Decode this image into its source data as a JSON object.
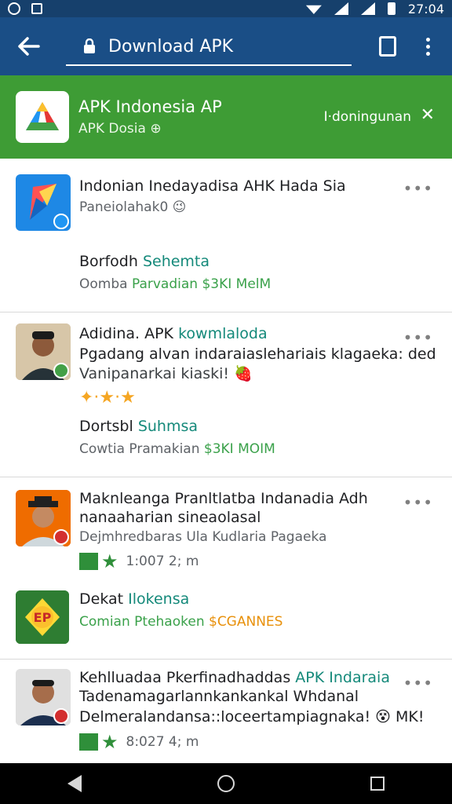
{
  "status": {
    "time": "27:04"
  },
  "toolbar": {
    "title": "Download APK"
  },
  "banner": {
    "title": "APK Indonesia AP",
    "subtitle": "APK Dosia",
    "subtitle_badge": "⊕",
    "action": "I·doningunan",
    "close": "✕"
  },
  "items": [
    {
      "title": "Indonian Inedayadisa AHK Hada Sia",
      "subtitle": "Paneiolahak0",
      "subtitle_emoji": "😉",
      "meta_label": "Borfodh",
      "meta_accent": "Sehemta",
      "footer_prefix": "Oomba",
      "footer_accent": "Parvadian $3KI MelM",
      "more": "•••"
    },
    {
      "title_prefix": "Adidina. APK",
      "title_accent": "kowmlaloda",
      "line2": "Pgadang alvan indaraiaslehariais klagaeka: ded",
      "line3": "Vanipanarkai kiaski!",
      "line3_emoji": "🍓",
      "stars": "✦·★·★",
      "meta_label": "Dortsbl",
      "meta_accent": "Suhmsa",
      "footer_prefix": "Cowtia Pramakian",
      "footer_accent": "$3KI MOIM",
      "more": "•••"
    },
    {
      "title": "Maknleanga Pranltlatba Indanadia Adh",
      "line2": "nanaaharian sineaolasal",
      "line3": "Dejmhredbaras Ula Kudlaria Pagaeka",
      "rating_text": "1:007 2; m",
      "more": "•••"
    },
    {
      "logo_text": "EP",
      "meta_label": "Dekat",
      "meta_accent": "Ilokensa",
      "footer_prefix": "Comian Ptehaoken",
      "footer_accent": "$CGANNES"
    },
    {
      "title_prefix": "Kehlluadaa Pkerfinadhaddas",
      "title_accent": "APK Indaraia",
      "line2": "Tadenamagarlannkankankal Whdanal",
      "line3": "Delmeralandansa::loceertampiagnaka!",
      "line3_emoji": "😵",
      "line3_suffix": "MK!",
      "rating_text": "8:027 4; m",
      "more": "•••"
    }
  ],
  "colors": {
    "status_bar": "#16406c",
    "toolbar": "#1a4e86",
    "banner": "#3e9c35",
    "accent_teal": "#14897a",
    "accent_green": "#3aa14a"
  }
}
